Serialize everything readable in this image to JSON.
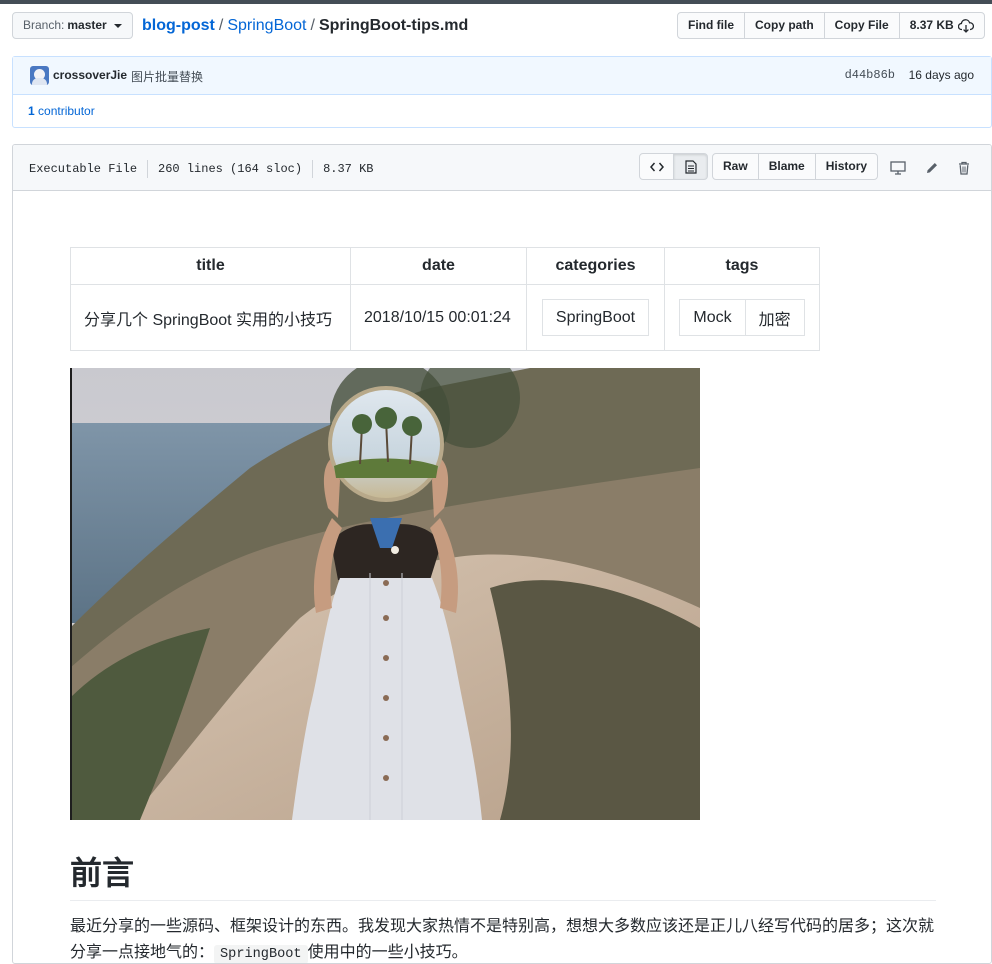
{
  "nav": {
    "branch_prefix": "Branch:",
    "branch_name": "master",
    "breadcrumb": {
      "root": "blog-post",
      "folder": "SpringBoot",
      "file": "SpringBoot-tips.md",
      "separator": "/"
    },
    "buttons": {
      "find_file": "Find file",
      "copy_path": "Copy path",
      "copy_file": "Copy File",
      "size": "8.37 KB"
    }
  },
  "commit": {
    "author": "crossoverJie",
    "message": "图片批量替换",
    "sha": "d44b86b",
    "time": "16 days ago",
    "contributor_count": "1",
    "contributor_label": "contributor"
  },
  "file": {
    "mode": "Executable File",
    "lines": "260 lines (164 sloc)",
    "size": "8.37 KB",
    "actions": {
      "raw": "Raw",
      "blame": "Blame",
      "history": "History"
    }
  },
  "front_matter": {
    "headers": [
      "title",
      "date",
      "categories",
      "tags"
    ],
    "title": "分享几个 SpringBoot 实用的小技巧",
    "date": "2018/10/15 00:01:24",
    "categories": [
      "SpringBoot"
    ],
    "tags": [
      "Mock",
      "加密"
    ]
  },
  "content": {
    "heading": "前言",
    "para_part1": "最近分享的一些源码、框架设计的东西。我发现大家热情不是特别高，想想大多数应该还是正儿八经写代码的居多；这次就分享一点接地气的：",
    "para_code": "SpringBoot",
    "para_part2": "使用中的一些小技巧。"
  },
  "colors": {
    "link": "#0366d6",
    "border": "#d1d5da",
    "commit_bg": "#f1f8ff"
  }
}
